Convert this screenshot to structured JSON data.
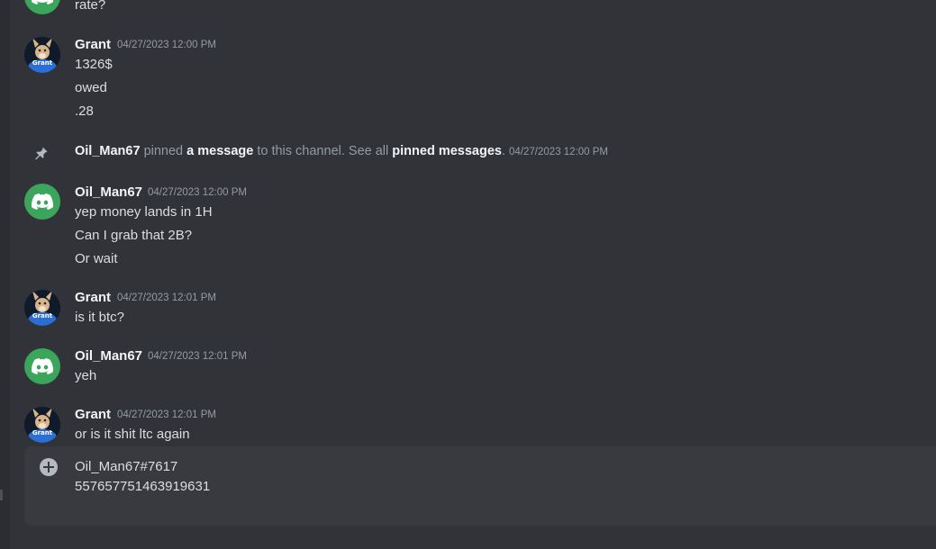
{
  "messages": [
    {
      "type": "partial",
      "avatar": "discord-logo-icon",
      "lines": [
        "rate?"
      ]
    },
    {
      "type": "message",
      "author": "Grant",
      "avatar": "grant-avatar-icon",
      "timestamp": "04/27/2023 12:00 PM",
      "lines": [
        "1326$",
        "owed",
        ".28"
      ]
    },
    {
      "type": "system",
      "icon": "pin-icon",
      "actor": "Oil_Man67",
      "before": "pinned",
      "link1": "a message",
      "middle": "to this channel. See all",
      "link2": "pinned messages",
      "after": ".",
      "timestamp": "04/27/2023 12:00 PM"
    },
    {
      "type": "message",
      "author": "Oil_Man67",
      "avatar": "discord-logo-icon",
      "timestamp": "04/27/2023 12:00 PM",
      "lines": [
        "yep money lands in 1H",
        "Can I grab that 2B?",
        "Or wait"
      ]
    },
    {
      "type": "message",
      "author": "Grant",
      "avatar": "grant-avatar-icon",
      "timestamp": "04/27/2023 12:01 PM",
      "lines": [
        "is it btc?"
      ]
    },
    {
      "type": "message",
      "author": "Oil_Man67",
      "avatar": "discord-logo-icon",
      "timestamp": "04/27/2023 12:01 PM",
      "lines": [
        "yeh"
      ]
    },
    {
      "type": "message",
      "author": "Grant",
      "avatar": "grant-avatar-icon",
      "timestamp": "04/27/2023 12:01 PM",
      "lines": [
        "or is it shit ltc again"
      ]
    }
  ],
  "composer": {
    "icon": "plus-circle-icon",
    "lines": [
      "Oil_Man67#7617",
      "557657751463919631"
    ]
  },
  "colors": {
    "background": "#313338",
    "discord_green": "#3ba55c",
    "composer_bg": "#383a40"
  }
}
